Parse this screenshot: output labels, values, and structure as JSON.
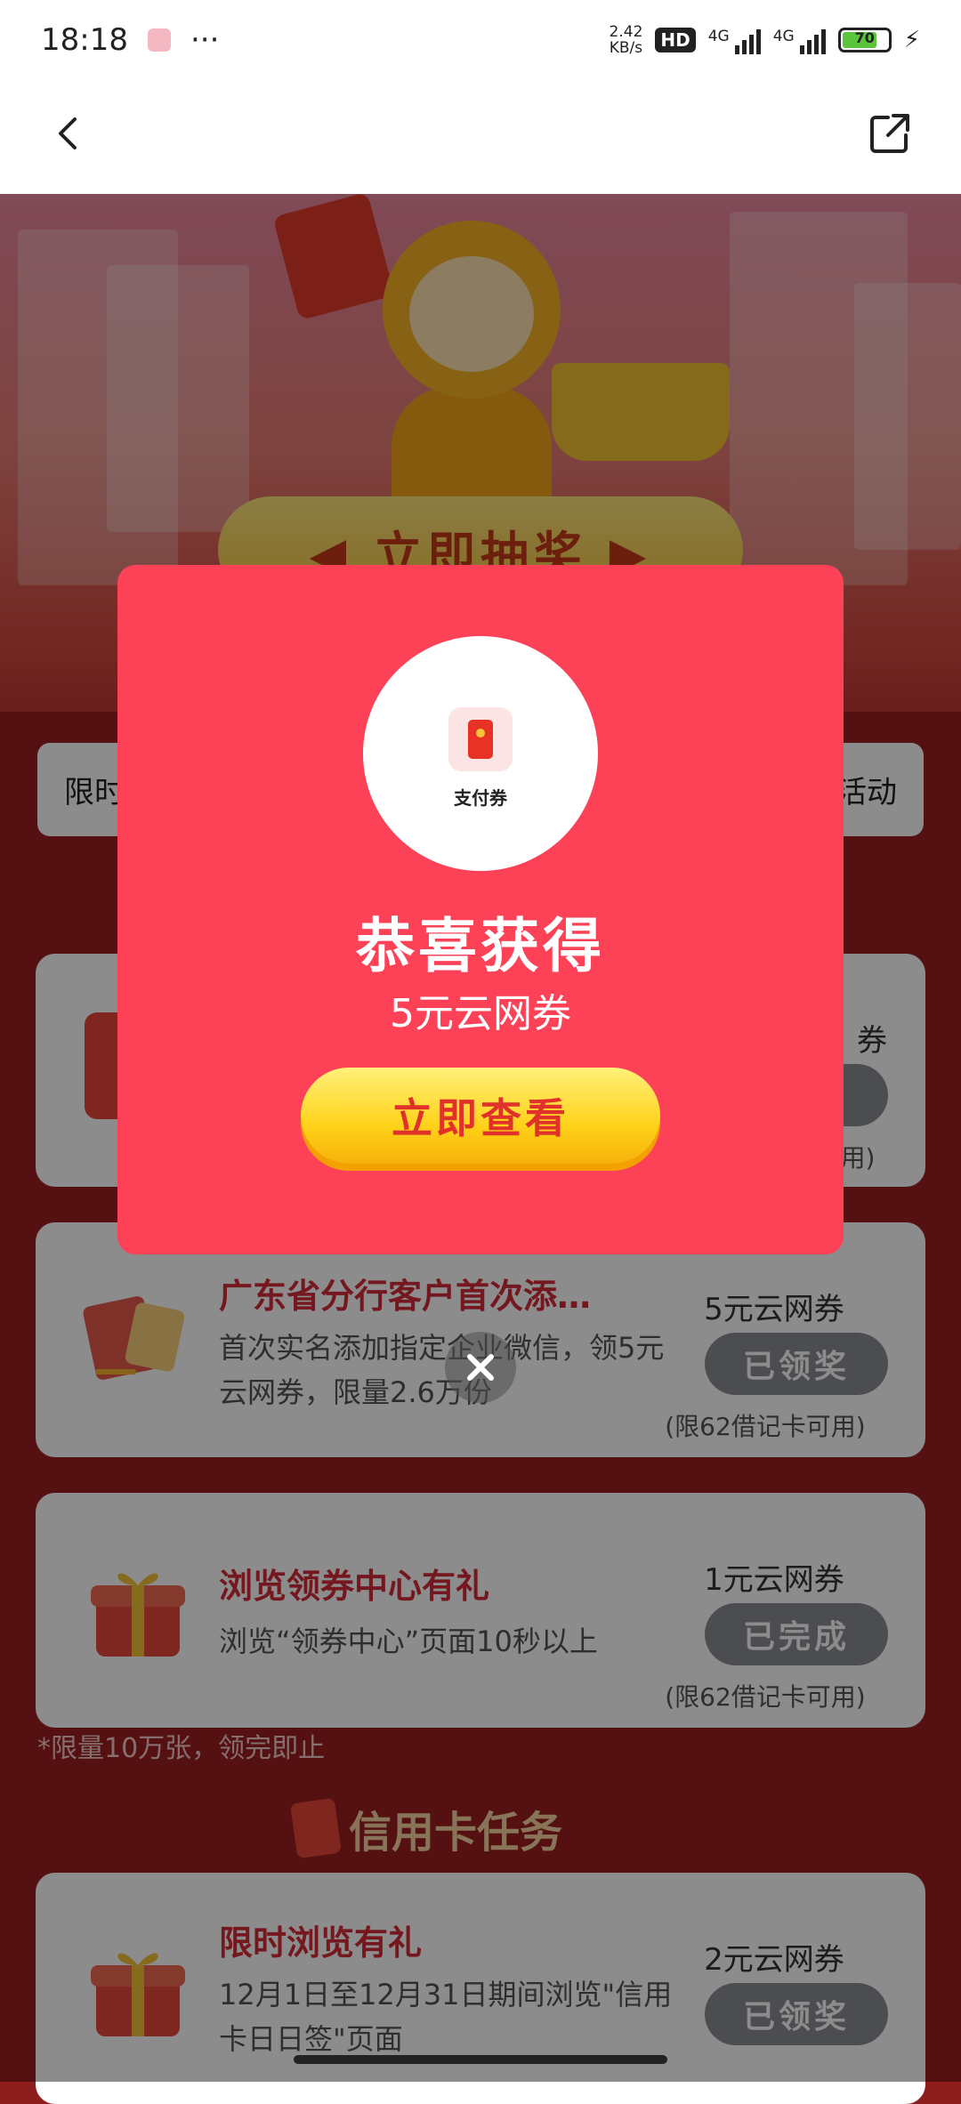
{
  "status_bar": {
    "time": "18:18",
    "more": "···",
    "speed_value": "2.42",
    "speed_unit": "KB/s",
    "hd": "HD",
    "net1": "4G",
    "net2": "4G",
    "battery": "70"
  },
  "banner": {
    "lottery_label": "◀ 立即抽奖 ▶"
  },
  "rule_strip": {
    "left": "限时",
    "right": "活动"
  },
  "tasks": [
    {
      "title": "",
      "desc": "",
      "reward": "券",
      "button": "",
      "limit": "可用)"
    },
    {
      "title": "广东省分行客户首次添…",
      "desc": "首次实名添加指定企业微信，领5元云网券，限量2.6万份",
      "reward": "5元云网券",
      "button": "已领奖",
      "limit": "(限62借记卡可用)"
    },
    {
      "title": "浏览领券中心有礼",
      "desc": "浏览“领券中心”页面10秒以上",
      "reward": "1元云网券",
      "button": "已完成",
      "limit": "(限62借记卡可用)"
    },
    {
      "title": "限时浏览有礼",
      "desc": "12月1日至12月31日期间浏览\"信用卡日日签\"页面",
      "reward": "2元云网券",
      "button": "已领奖",
      "limit": ""
    }
  ],
  "note": "*限量10万张，领完即止",
  "section": {
    "title": "信用卡任务"
  },
  "modal": {
    "coupon_label": "支付券",
    "title": "恭喜获得",
    "subtitle": "5元云网券",
    "button": "立即查看"
  },
  "colors": {
    "modal_bg": "#fd4258",
    "title_red": "#d42a3a",
    "claimed_gray": "#8a8d93"
  }
}
